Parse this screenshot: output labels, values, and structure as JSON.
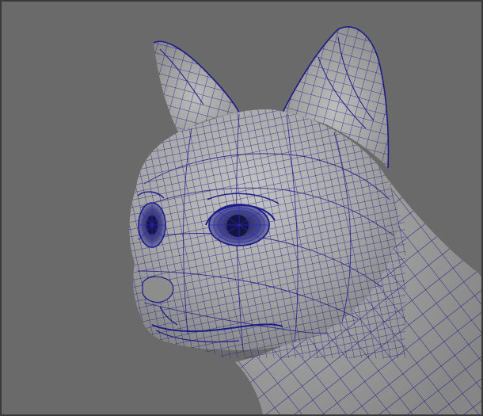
{
  "viewport": {
    "background_color": "#6a6a6a",
    "border_color": "#3a3a3a"
  },
  "model": {
    "subject": "cat-head-wireframe",
    "surface_color": "#a2a2a2",
    "wire_color": "#1c1c8a",
    "wire_highlight_color": "#2a2ac8",
    "shading": "smooth-shaded-with-wireframe"
  }
}
